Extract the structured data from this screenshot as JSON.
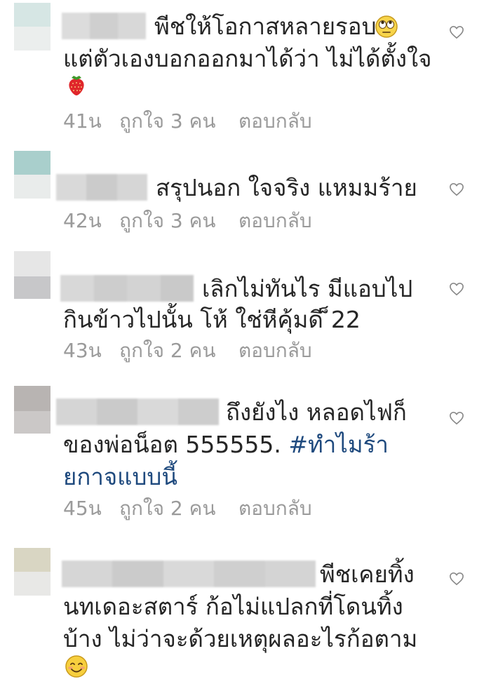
{
  "comments": [
    {
      "line1": "พีชให้โอกาสหลายรอบ",
      "line2": "แต่ตัวเองบอกออกมาได้ว่า ไม่ได้ตั้งใจ",
      "time": "41น",
      "likes": "ถูกใจ 3 คน",
      "reply": "ตอบกลับ",
      "emojis": [
        "eye-roll-emoji",
        "strawberry-emoji"
      ]
    },
    {
      "line1": "สรุปนอก ใจจริง แหมมร้าย",
      "time": "42น",
      "likes": "ถูกใจ 3 คน",
      "reply": "ตอบกลับ"
    },
    {
      "line1": "เลิกไม่ทันไร  มีแอบไป",
      "line2": "กินข้าวไปนั้น โห้ ใช่หีคุ้มดี ็22",
      "time": "43น",
      "likes": "ถูกใจ 2 คน",
      "reply": "ตอบกลับ"
    },
    {
      "line1": "ถึงยังไง หลอดไฟก็",
      "line2": "ของพ่อน็อต 555555.",
      "hashtag_part1": "#ทำไมร้า",
      "hashtag_part2": "ยกาจแบบนี้",
      "time": "45น",
      "likes": "ถูกใจ 2 คน",
      "reply": "ตอบกลับ"
    },
    {
      "line1": "พีชเคยทิ้ง",
      "line2": "นทเดอะสตาร์ ก้อไม่แปลกที่โดนทิ้ง",
      "line3": "บ้าง ไม่ว่าจะด้วยเหตุผลอะไรก้อตาม",
      "emojis": [
        "smiling-emoji"
      ]
    }
  ],
  "colors": {
    "text": "#262626",
    "meta": "#9a9a9a",
    "hashtag": "#1f4a7e",
    "blur": "#d4d4d4"
  },
  "icons": {
    "like": "heart-outline-icon"
  }
}
